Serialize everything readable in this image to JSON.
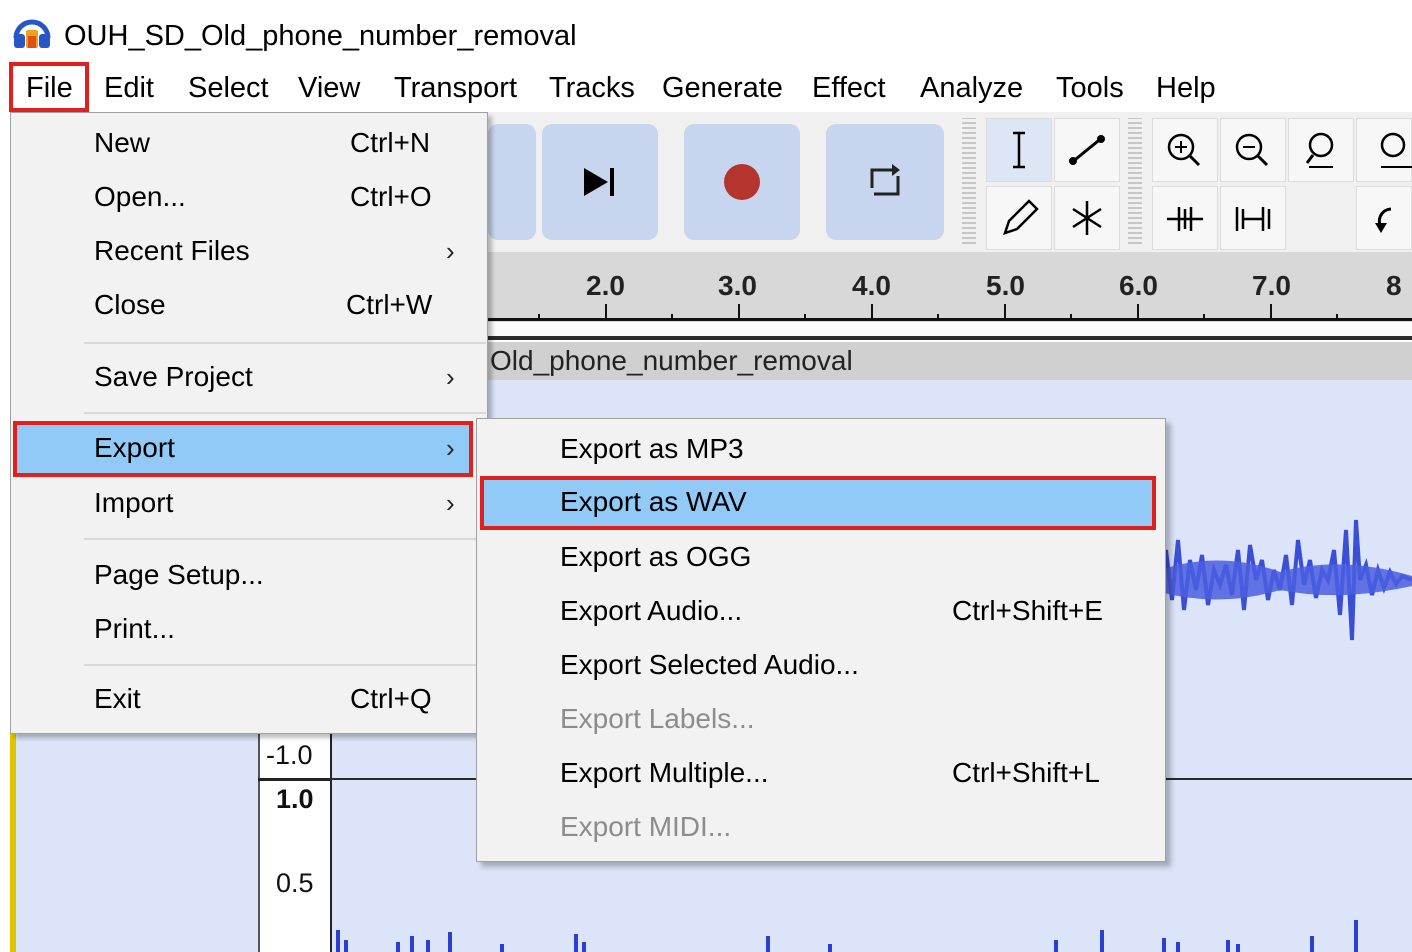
{
  "window": {
    "title": "OUH_SD_Old_phone_number_removal",
    "icon": "headphones-icon"
  },
  "menubar": {
    "items": [
      "File",
      "Edit",
      "Select",
      "View",
      "Transport",
      "Tracks",
      "Generate",
      "Effect",
      "Analyze",
      "Tools",
      "Help"
    ],
    "open": "File"
  },
  "toolbar": {
    "buttons": [
      "skip-to-end-icon",
      "record-icon",
      "loop-icon"
    ],
    "tools": [
      "selection-tool-icon",
      "envelope-tool-icon",
      "draw-tool-icon",
      "multi-tool-icon",
      "zoom-in-icon",
      "zoom-out-icon",
      "fit-selection-icon",
      "fit-project-icon",
      "trim-audio-icon",
      "silence-audio-icon",
      "undo-icon"
    ]
  },
  "ruler": {
    "labels": [
      "2.0",
      "3.0",
      "4.0",
      "5.0",
      "6.0",
      "7.0",
      "8"
    ]
  },
  "track": {
    "name": "Old_phone_number_removal",
    "scale": [
      "-1.0",
      "1.0",
      "0.5"
    ]
  },
  "file_menu": {
    "items": [
      {
        "label": "New",
        "shortcut": "Ctrl+N"
      },
      {
        "label": "Open...",
        "shortcut": "Ctrl+O"
      },
      {
        "label": "Recent Files",
        "submenu": true
      },
      {
        "label": "Close",
        "shortcut": "Ctrl+W"
      },
      {
        "label": "Save Project",
        "submenu": true
      },
      {
        "label": "Export",
        "submenu": true,
        "highlighted": true
      },
      {
        "label": "Import",
        "submenu": true
      },
      {
        "label": "Page Setup..."
      },
      {
        "label": "Print..."
      },
      {
        "label": "Exit",
        "shortcut": "Ctrl+Q"
      }
    ],
    "arrow": "›"
  },
  "export_menu": {
    "items": [
      {
        "label": "Export as MP3"
      },
      {
        "label": "Export as WAV",
        "highlighted": true
      },
      {
        "label": "Export as OGG"
      },
      {
        "label": "Export Audio...",
        "shortcut": "Ctrl+Shift+E"
      },
      {
        "label": "Export Selected Audio..."
      },
      {
        "label": "Export Labels...",
        "disabled": true
      },
      {
        "label": "Export Multiple...",
        "shortcut": "Ctrl+Shift+L"
      },
      {
        "label": "Export MIDI...",
        "disabled": true
      }
    ]
  },
  "colors": {
    "highlight": "#91c9f7",
    "annotation": "#e0201e",
    "waveform": "#3a4fd6",
    "record": "#b5352e"
  }
}
